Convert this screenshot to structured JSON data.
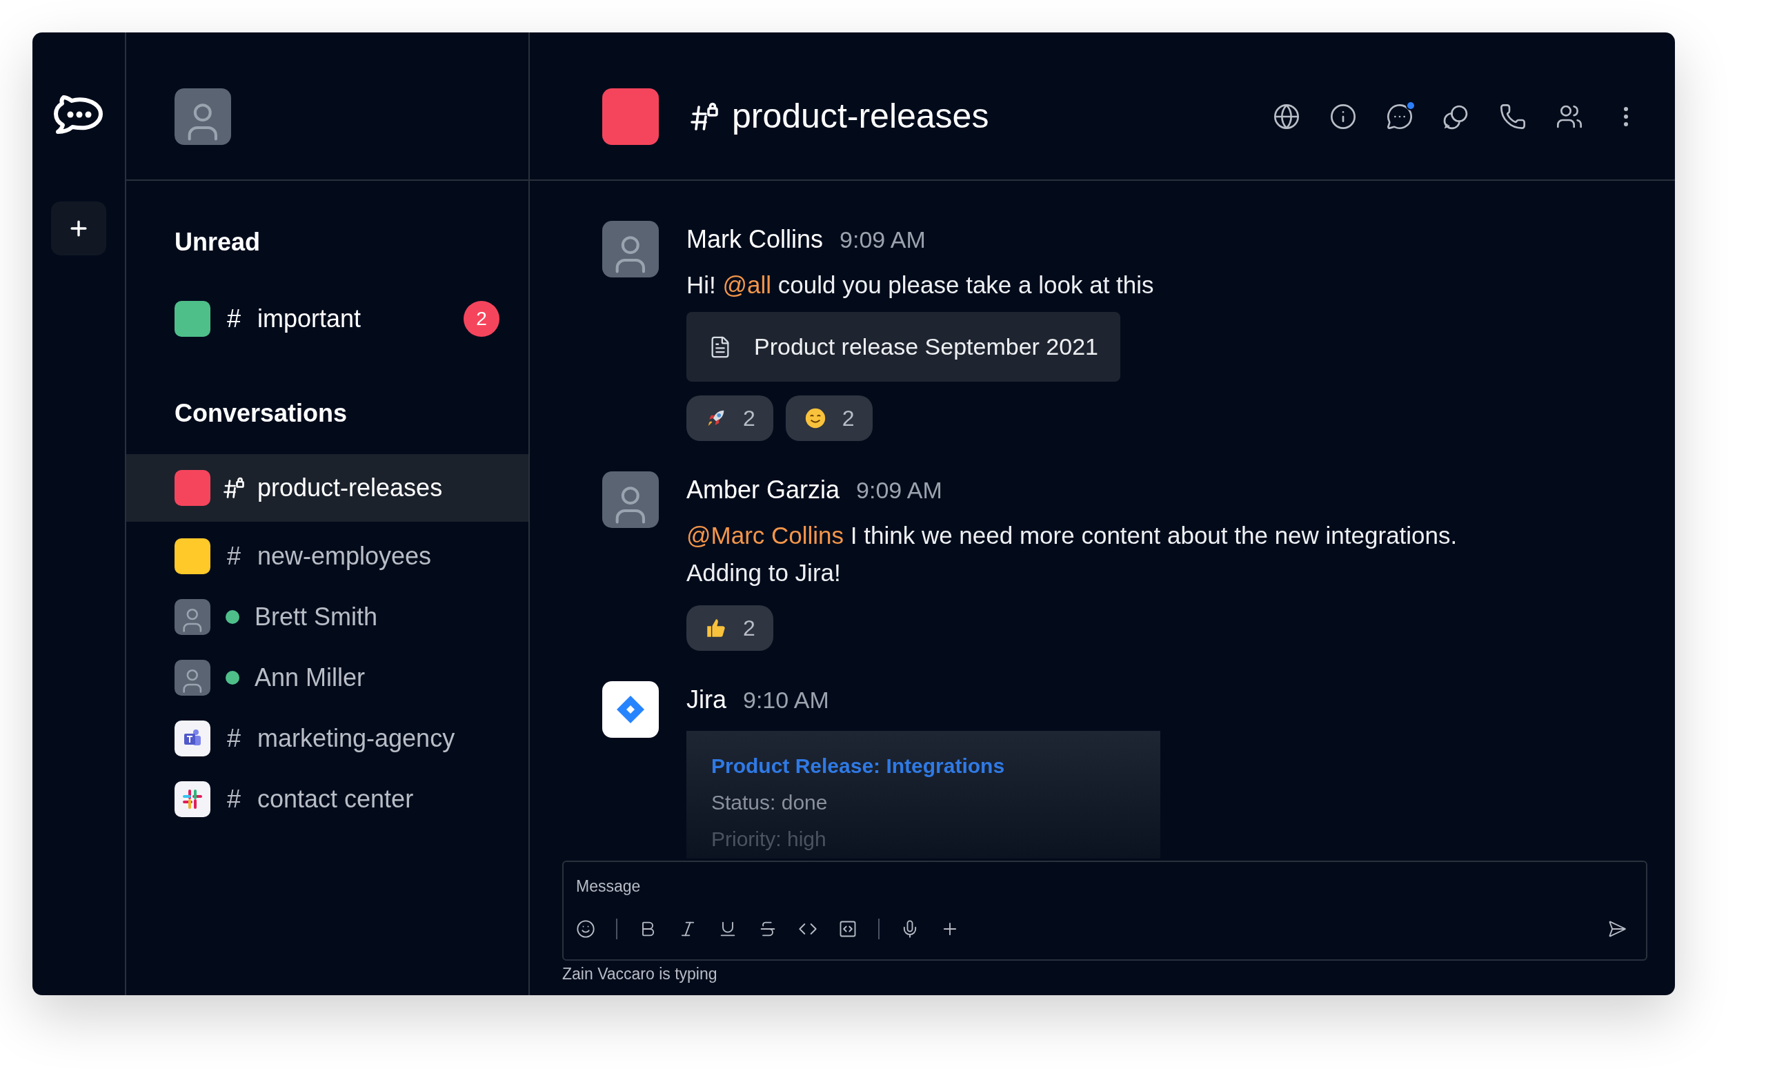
{
  "channel": {
    "title": "product-releases",
    "color": "#f5455c",
    "private": true
  },
  "header_actions": [
    {
      "kind": "globe",
      "notify": false
    },
    {
      "kind": "info",
      "notify": false
    },
    {
      "kind": "threads",
      "notify": true
    },
    {
      "kind": "discussions",
      "notify": false
    },
    {
      "kind": "call",
      "notify": false
    },
    {
      "kind": "members",
      "notify": false
    },
    {
      "kind": "more",
      "notify": false
    }
  ],
  "sidebar": [
    {
      "title": "Unread",
      "items": [
        {
          "kind": "channel",
          "label": "important",
          "color": "#4fbf8a",
          "badge": "2",
          "selected": false,
          "private": false,
          "prefix": "#"
        }
      ]
    },
    {
      "title": "Conversations",
      "items": [
        {
          "kind": "channel",
          "label": "product-releases",
          "color": "#f5455c",
          "selected": true,
          "private": true
        },
        {
          "kind": "channel",
          "label": "new-employees",
          "color": "#ffc929",
          "selected": false,
          "private": false,
          "prefix": "#"
        },
        {
          "kind": "user",
          "label": "Brett Smith",
          "online": true,
          "selected": false
        },
        {
          "kind": "user",
          "label": "Ann Miller",
          "online": true,
          "selected": false
        },
        {
          "kind": "team_app",
          "label": "marketing-agency",
          "selected": false,
          "private": false,
          "prefix": "#"
        },
        {
          "kind": "chat_app",
          "label": "contact center",
          "selected": false,
          "private": false,
          "prefix": "#"
        }
      ]
    }
  ],
  "messages": [
    {
      "kind": "person",
      "author": "Mark Collins",
      "time": "9:09 AM",
      "text": [
        {
          "kind": "plain",
          "text": "Hi! "
        },
        {
          "kind": "mention",
          "text": "@all"
        },
        {
          "kind": "plain",
          "text": " could you please take a look at this"
        }
      ],
      "attachment": "Product release September 2021",
      "reactions": [
        {
          "kind": "rocket",
          "count": "2"
        },
        {
          "kind": "smile",
          "count": "2"
        }
      ]
    },
    {
      "kind": "person",
      "author": "Amber Garzia",
      "time": "9:09 AM",
      "text": [
        {
          "kind": "mention",
          "text": "@Marc Collins"
        },
        {
          "kind": "plain",
          "text": " I think we need more content about the new integrations. Adding to Jira!"
        }
      ],
      "reactions": [
        {
          "kind": "thumbs_up",
          "count": "2"
        }
      ]
    },
    {
      "kind": "app",
      "author": "Jira",
      "time": "9:10 AM",
      "card": {
        "title": "Product Release: Integrations",
        "fields": [
          "Status: done",
          "Priority: high"
        ]
      }
    }
  ],
  "composer": {
    "placeholder": "Message",
    "tools": [
      {
        "kind": "emoji"
      },
      {
        "kind": "sep"
      },
      {
        "kind": "bold"
      },
      {
        "kind": "italic"
      },
      {
        "kind": "underline"
      },
      {
        "kind": "strike"
      },
      {
        "kind": "code"
      },
      {
        "kind": "code_block"
      },
      {
        "kind": "sep"
      },
      {
        "kind": "mic"
      },
      {
        "kind": "plus"
      }
    ],
    "typing": "Zain Vaccaro is typing"
  }
}
